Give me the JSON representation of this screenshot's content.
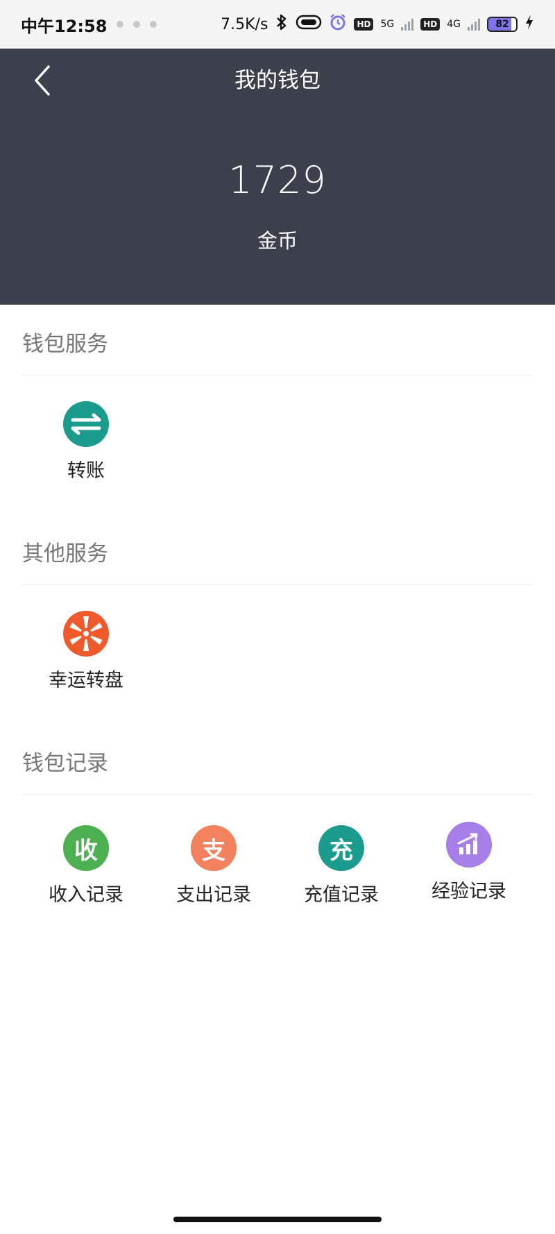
{
  "status_bar": {
    "time": "中午12:58",
    "network_speed": "7.5K/s",
    "hd1": "HD",
    "net1": "5G",
    "hd2": "HD",
    "net2": "4G",
    "battery": "82"
  },
  "header": {
    "title": "我的钱包",
    "balance": "1729",
    "unit": "金币"
  },
  "sections": {
    "wallet_services": {
      "title": "钱包服务",
      "items": [
        {
          "label": "转账",
          "icon": "transfer-icon",
          "color": "#1a9b8b"
        }
      ]
    },
    "other_services": {
      "title": "其他服务",
      "items": [
        {
          "label": "幸运转盘",
          "icon": "lucky-wheel-icon",
          "color": "#ee5a2b"
        }
      ]
    },
    "wallet_records": {
      "title": "钱包记录",
      "items": [
        {
          "label": "收入记录",
          "glyph": "收",
          "icon": "income-icon",
          "color": "#4caf50"
        },
        {
          "label": "支出记录",
          "glyph": "支",
          "icon": "expense-icon",
          "color": "#f2825e"
        },
        {
          "label": "充值记录",
          "glyph": "充",
          "icon": "recharge-icon",
          "color": "#1a9b8b"
        },
        {
          "label": "经验记录",
          "icon": "experience-chart-icon",
          "color": "#a77ee8"
        }
      ]
    }
  }
}
